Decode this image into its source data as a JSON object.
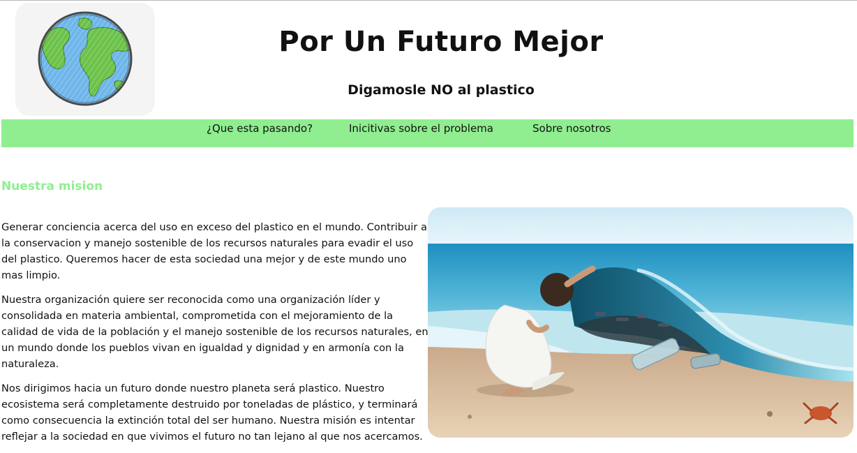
{
  "header": {
    "title": "Por Un Futuro Mejor",
    "subtitle": "Digamosle NO al plastico",
    "logo_icon": "earth-globe-icon"
  },
  "nav": {
    "items": [
      {
        "label": "¿Que esta pasando?"
      },
      {
        "label": "Inicitivas sobre el problema"
      },
      {
        "label": "Sobre nosotros"
      }
    ],
    "background": "#90ee90"
  },
  "mission": {
    "heading": "Nuestra mision",
    "heading_color": "#90ee90",
    "paragraphs": [
      "Generar conciencia acerca del uso en exceso del plastico en el mundo. Contribuir a la conservacion y manejo sostenible de los recursos naturales para evadir el uso del plastico. Queremos hacer de esta sociedad una mejor y de este mundo uno mas limpio.",
      "Nuestra organización quiere ser reconocida como una organización líder y consolidada en materia ambiental, comprometida con el mejoramiento de la calidad de vida de la población y el manejo sostenible de los recursos naturales, en un mundo donde los pueblos vivan en igualdad y dignidad y en armonía con la naturaleza.",
      "Nos dirigimos hacia un futuro donde nuestro planeta será plastico. Nuestro ecosistema será completamente destruido por toneladas de plástico, y terminará como consecuencia la extinción total del ser humano. Nuestra misión es intentar reflejar a la sociedad en que vivimos el futuro no tan lejano al que nos acercamos."
    ]
  },
  "hero_image": {
    "icon": "beach-plastic-photo"
  }
}
